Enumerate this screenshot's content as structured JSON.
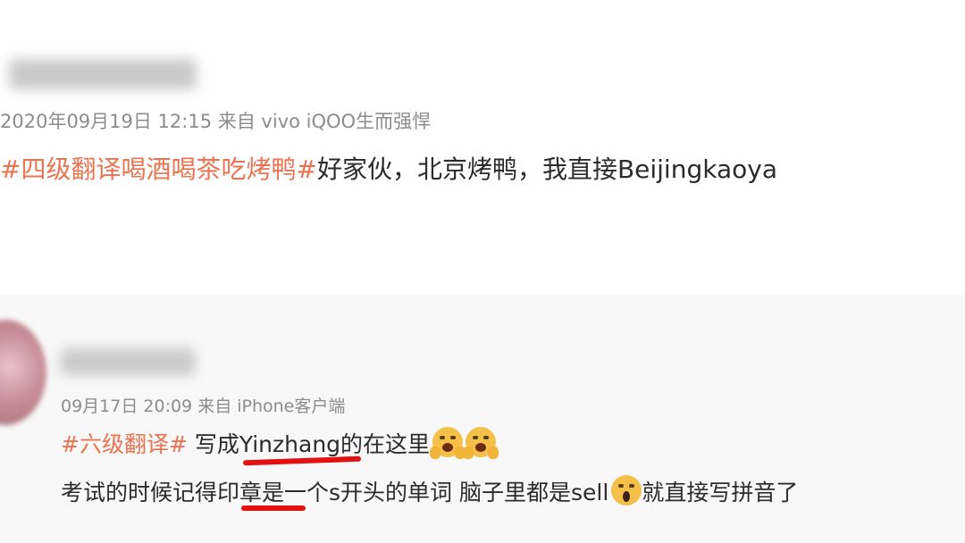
{
  "post1": {
    "username": "",
    "meta": "2020年09月19日 12:15  来自 vivo iQOO生而强悍",
    "hashtag": "#四级翻译喝酒喝茶吃烤鸭#",
    "text": "好家伙，北京烤鸭，我直接Beijingkaoya"
  },
  "post2": {
    "username": "",
    "meta": "09月17日 20:09  来自 iPhone客户端",
    "hashtag": "#六级翻译#",
    "line1_a": " 写成",
    "line1_b": "Yinzhang",
    "line1_c": "的在这里",
    "line2_a": "考试的时候记得",
    "line2_b": "印章",
    "line2_c": "是一个s开头的单词 脑子里都是sell",
    "line2_d": "就直接写拼音了"
  },
  "colors": {
    "hashtag": "#eb7350",
    "underline": "#e51010",
    "meta": "#8c8c8c",
    "text": "#2b2b2b"
  },
  "icons": [
    "scream-emoji-icon",
    "scream-emoji-icon",
    "shocked-emoji-icon"
  ]
}
